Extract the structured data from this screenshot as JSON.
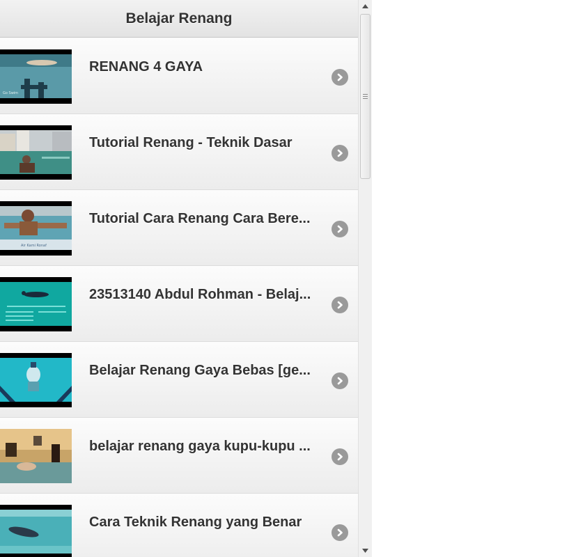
{
  "header": {
    "title": "Belajar Renang"
  },
  "list": {
    "items": [
      {
        "title": "RENANG 4 GAYA"
      },
      {
        "title": "Tutorial Renang - Teknik Dasar"
      },
      {
        "title": "Tutorial Cara Renang Cara Bere..."
      },
      {
        "title": "23513140 Abdul Rohman - Belaj..."
      },
      {
        "title": "Belajar Renang Gaya Bebas [ge..."
      },
      {
        "title": "belajar renang gaya kupu-kupu ..."
      },
      {
        "title": "Cara Teknik Renang yang Benar"
      }
    ]
  },
  "icons": {
    "row_arrow": "chevron-right-circle-icon",
    "scroll_up": "scroll-up-arrow-icon",
    "scroll_down": "scroll-down-arrow-icon"
  },
  "colors": {
    "header_text": "#333333",
    "arrow_circle": "#9a9a9a",
    "row_bg": "#f6f6f6"
  }
}
